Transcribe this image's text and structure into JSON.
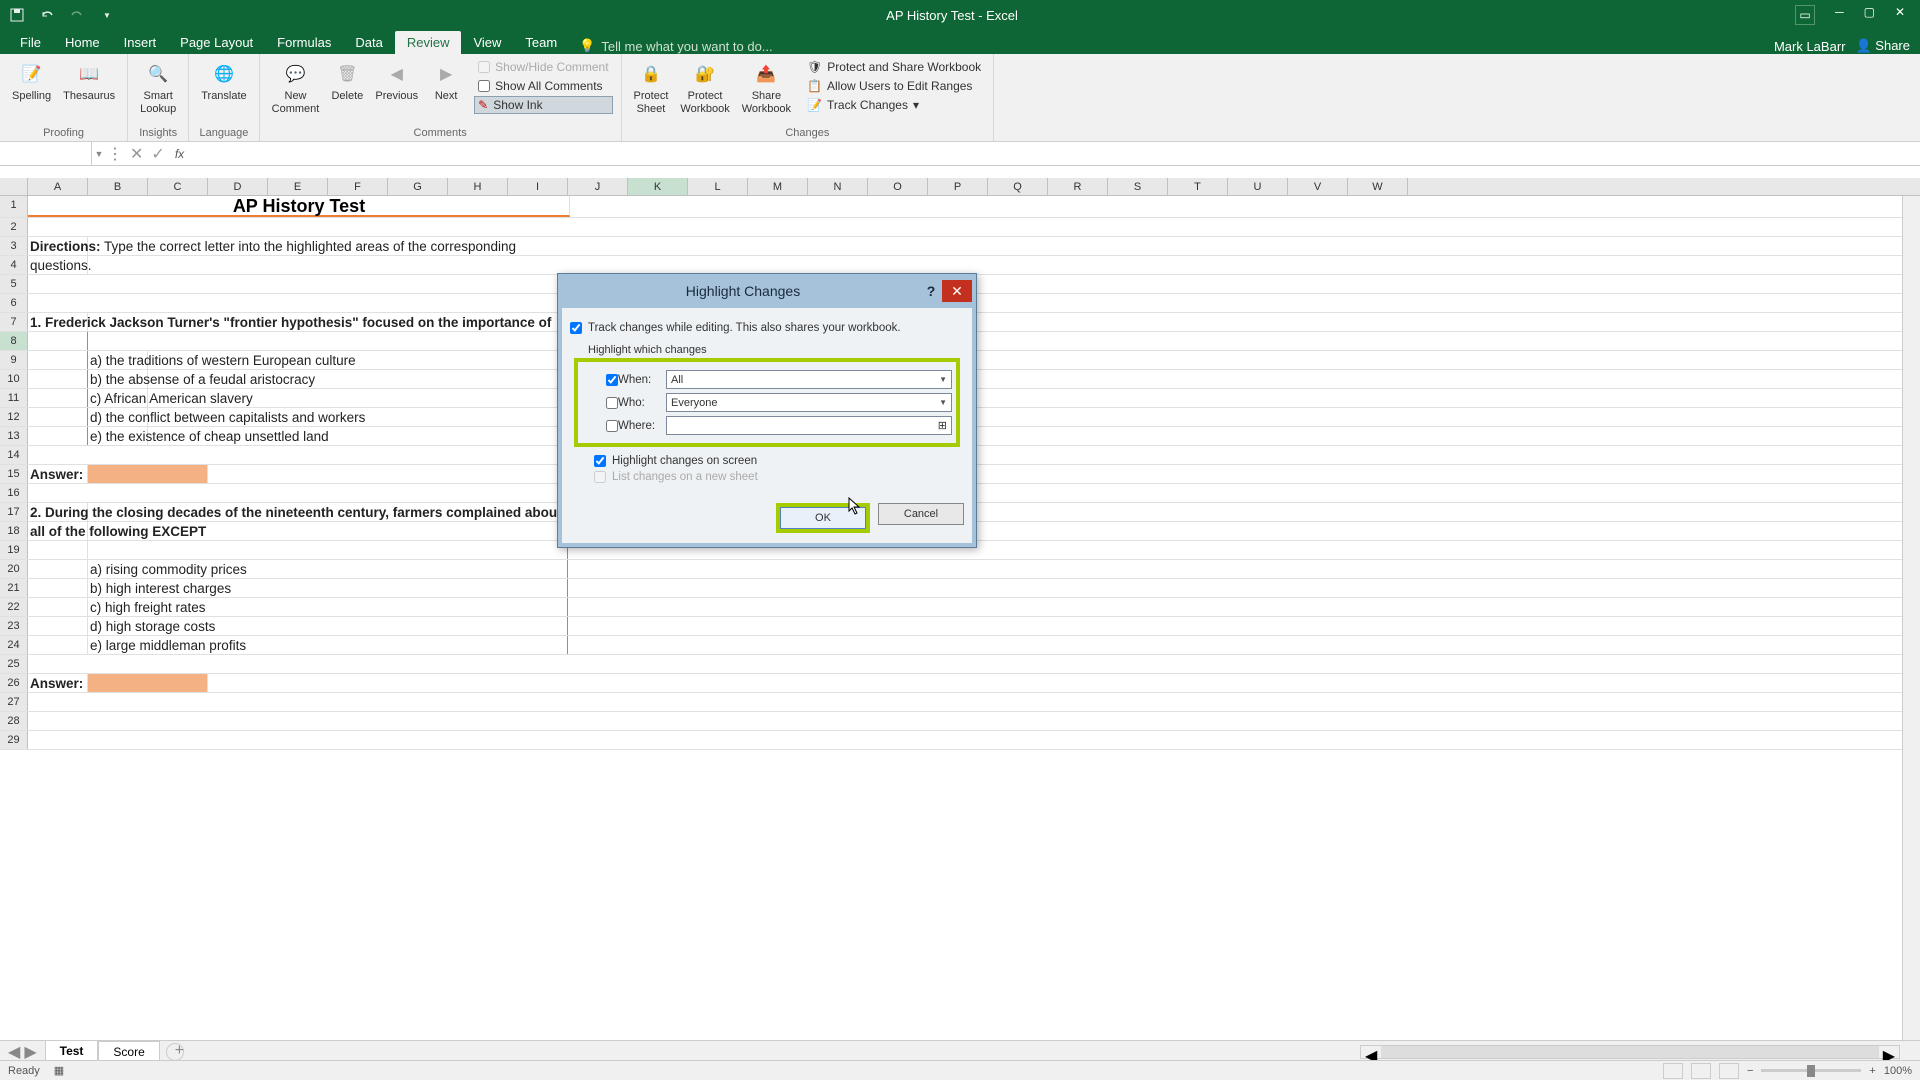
{
  "titlebar": {
    "title": "AP History Test - Excel"
  },
  "user": {
    "name": "Mark LaBarr",
    "share": "Share"
  },
  "tabs": [
    "File",
    "Home",
    "Insert",
    "Page Layout",
    "Formulas",
    "Data",
    "Review",
    "View",
    "Team"
  ],
  "active_tab": "Review",
  "tellme": "Tell me what you want to do...",
  "ribbon": {
    "proofing": {
      "label": "Proofing",
      "spelling": "Spelling",
      "thesaurus": "Thesaurus"
    },
    "insights": {
      "label": "Insights",
      "smart_lookup": "Smart\nLookup"
    },
    "language": {
      "label": "Language",
      "translate": "Translate"
    },
    "comments": {
      "label": "Comments",
      "new": "New\nComment",
      "delete": "Delete",
      "previous": "Previous",
      "next": "Next",
      "showhide": "Show/Hide Comment",
      "showall": "Show All Comments",
      "showink": "Show Ink"
    },
    "changes": {
      "label": "Changes",
      "protect_sheet": "Protect\nSheet",
      "protect_wb": "Protect\nWorkbook",
      "share_wb": "Share\nWorkbook",
      "protect_share": "Protect and Share Workbook",
      "allow_edit": "Allow Users to Edit Ranges",
      "track_changes": "Track Changes"
    }
  },
  "formula_bar": {
    "namebox": "",
    "formula": ""
  },
  "columns": [
    "A",
    "B",
    "C",
    "D",
    "E",
    "F",
    "G",
    "H",
    "I",
    "J",
    "K",
    "L",
    "M",
    "N",
    "O",
    "P",
    "Q",
    "R",
    "S",
    "T",
    "U",
    "V",
    "W"
  ],
  "active_col": "K",
  "cells": {
    "title": "AP History Test",
    "directions_label": "Directions:",
    "directions_text": " Type the correct letter into the highlighted areas of the corresponding",
    "questions": "questions.",
    "q1": "1. Frederick Jackson Turner's \"frontier hypothesis\" focused on the importance of",
    "a1a": "a) the traditions of western European culture",
    "a1b": "b) the absense of a feudal aristocracy",
    "a1c": "c) African American slavery",
    "a1d": "d) the conflict between capitalists and workers",
    "a1e": "e) the existence of cheap unsettled land",
    "answer_label": "Answer:",
    "q2": "2. During the closing decades of the nineteenth century, farmers complained about",
    "q2b": "all of the following EXCEPT",
    "a2a": "a) rising commodity prices",
    "a2b": "b) high interest charges",
    "a2c": "c) high freight rates",
    "a2d": "d) high storage costs",
    "a2e": "e) large middleman profits"
  },
  "dialog": {
    "title": "Highlight Changes",
    "track_label": "Track changes while editing. This also shares your workbook.",
    "section_label": "Highlight which changes",
    "when_label": "When:",
    "when_value": "All",
    "who_label": "Who:",
    "who_value": "Everyone",
    "where_label": "Where:",
    "where_value": "",
    "screen_label": "Highlight changes on screen",
    "list_label": "List changes on a new sheet",
    "ok": "OK",
    "cancel": "Cancel"
  },
  "sheets": {
    "tabs": [
      "Test",
      "Score"
    ],
    "active": "Test"
  },
  "statusbar": {
    "ready": "Ready",
    "zoom": "100%"
  }
}
